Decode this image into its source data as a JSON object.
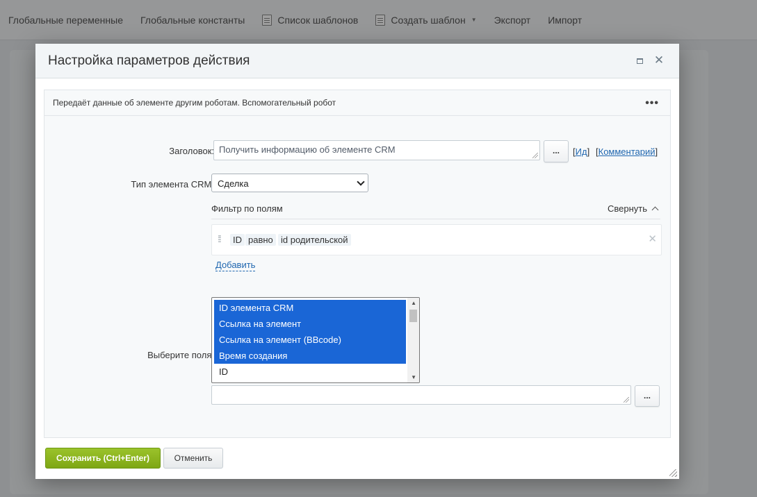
{
  "background": {
    "nav": [
      {
        "label": "Глобальные переменные",
        "icon": ""
      },
      {
        "label": "Глобальные константы",
        "icon": ""
      },
      {
        "label": "Список шаблонов",
        "icon": "template-list-icon"
      },
      {
        "label": "Создать шаблон",
        "icon": "create-template-icon"
      },
      {
        "label": "Экспорт",
        "icon": ""
      },
      {
        "label": "Импорт",
        "icon": ""
      }
    ]
  },
  "dialog": {
    "title": "Настройка параметров действия",
    "description": "Передаёт данные об элементе другим роботам. Вспомогательный робот",
    "title_field": {
      "label": "Заголовок:",
      "value": "Получить информацию об элементе CRM",
      "dots": "...",
      "id_link": "Ид",
      "comment_link": "Комментарий"
    },
    "entity_type": {
      "label": "Тип элемента CRM:",
      "value": "Сделка"
    },
    "filter": {
      "title": "Фильтр по полям",
      "collapse_label": "Свернуть",
      "row": {
        "field": "ID",
        "operator": "равно",
        "value": "id родительской"
      },
      "add_label": "Добавить"
    },
    "fields": {
      "label": "Выберите поля:",
      "options": [
        {
          "label": "ID элемента CRM",
          "selected": true
        },
        {
          "label": "Ссылка на элемент",
          "selected": true
        },
        {
          "label": "Ссылка на элемент (BBcode)",
          "selected": true
        },
        {
          "label": "Время создания",
          "selected": true
        },
        {
          "label": "ID",
          "selected": false
        }
      ],
      "extra_value": "",
      "dots": "..."
    },
    "buttons": {
      "save": "Сохранить (Ctrl+Enter)",
      "cancel": "Отменить"
    }
  },
  "colors": {
    "accent_save": "#8ab61e",
    "selection": "#1a66d6",
    "link": "#2067b0"
  }
}
